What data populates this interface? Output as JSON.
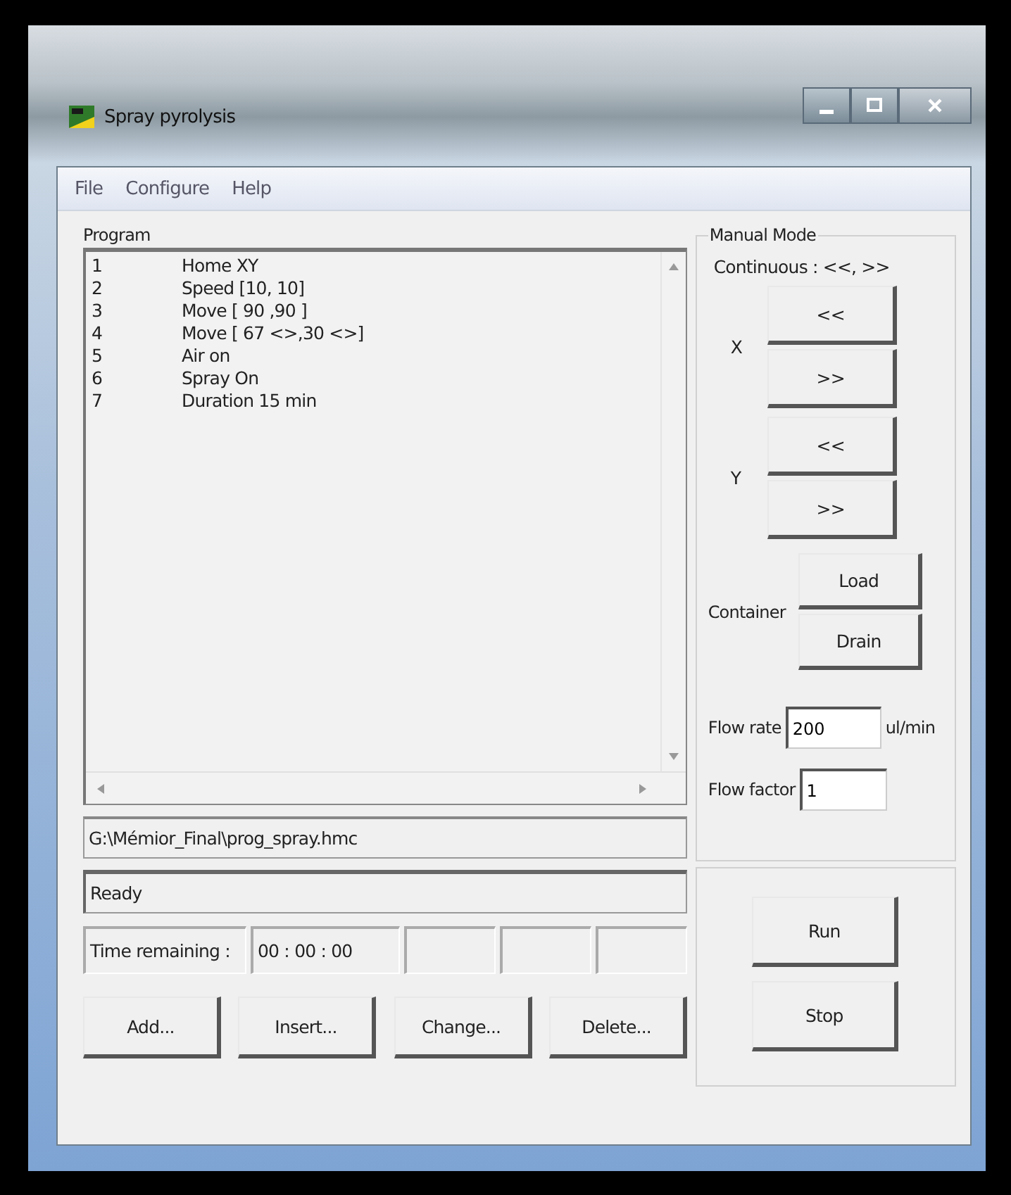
{
  "window": {
    "title": "Spray pyrolysis"
  },
  "menu": [
    "File",
    "Configure",
    "Help"
  ],
  "program": {
    "label": "Program",
    "rows": [
      {
        "number": "1",
        "command": "Home XY"
      },
      {
        "number": "2",
        "command": "Speed [10, 10]"
      },
      {
        "number": "3",
        "command": "Move [ 90 ,90 ]"
      },
      {
        "number": "4",
        "command": "Move [ 67 <>,30 <>]"
      },
      {
        "number": "5",
        "command": "Air on"
      },
      {
        "number": "6",
        "command": "Spray On"
      },
      {
        "number": "7",
        "command": "Duration 15 min"
      }
    ]
  },
  "file_path": "G:\\Mémior_Final\\prog_spray.hmc",
  "status": "Ready",
  "time_remaining": {
    "label": "Time remaining :",
    "value": "00 : 00 : 00"
  },
  "buttons": [
    "Add...",
    "Insert...",
    "Change...",
    "Delete..."
  ],
  "manual_mode": {
    "title": "Manual Mode",
    "continuous": "Continuous : <<, >>",
    "axes": [
      {
        "label": "X",
        "buttons": [
          "<<",
          ">>"
        ]
      },
      {
        "label": "Y",
        "buttons": [
          "<<",
          ">>"
        ]
      }
    ],
    "container": {
      "label": "Container",
      "buttons": [
        "Load",
        "Drain"
      ]
    },
    "flow_rate": {
      "label": "Flow rate",
      "value": "200",
      "unit": "ul/min"
    },
    "flow_factor": {
      "label": "Flow factor",
      "value": "1"
    }
  },
  "run_buttons": [
    "Run",
    "Stop"
  ]
}
